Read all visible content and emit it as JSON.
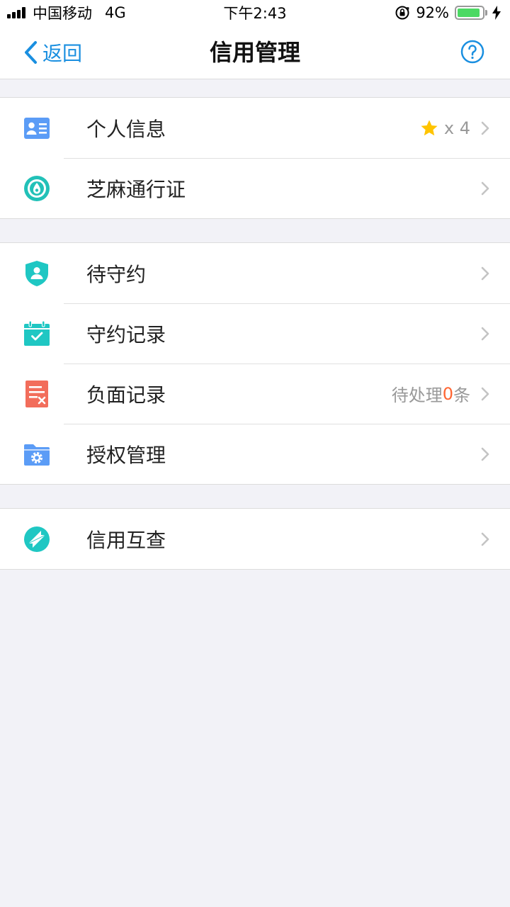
{
  "status_bar": {
    "carrier": "中国移动",
    "network": "4G",
    "time": "下午2:43",
    "battery": "92%",
    "battery_level": 0.92
  },
  "nav": {
    "back_label": "返回",
    "title": "信用管理",
    "help_icon": "question-circle-icon",
    "accent_color": "#1a8fe0"
  },
  "groups": [
    {
      "items": [
        {
          "label": "个人信息",
          "icon": "id-card-icon",
          "icon_color": "#4a8ef5",
          "stars_text": "x 4",
          "star_count": 4
        },
        {
          "label": "芝麻通行证",
          "icon": "sesame-pass-icon",
          "icon_color": "#22c1b8"
        }
      ]
    },
    {
      "items": [
        {
          "label": "待守约",
          "icon": "shield-user-icon",
          "icon_color": "#1fc7c3"
        },
        {
          "label": "守约记录",
          "icon": "calendar-check-icon",
          "icon_color": "#1fc7c3"
        },
        {
          "label": "负面记录",
          "icon": "document-x-icon",
          "icon_color": "#f26d5b",
          "pending_prefix": "待处理",
          "pending_count": "0",
          "pending_suffix": "条"
        },
        {
          "label": "授权管理",
          "icon": "folder-gear-icon",
          "icon_color": "#4a8ef5"
        }
      ]
    },
    {
      "items": [
        {
          "label": "信用互查",
          "icon": "credit-exchange-icon",
          "icon_color": "#1fc7c3"
        }
      ]
    }
  ]
}
